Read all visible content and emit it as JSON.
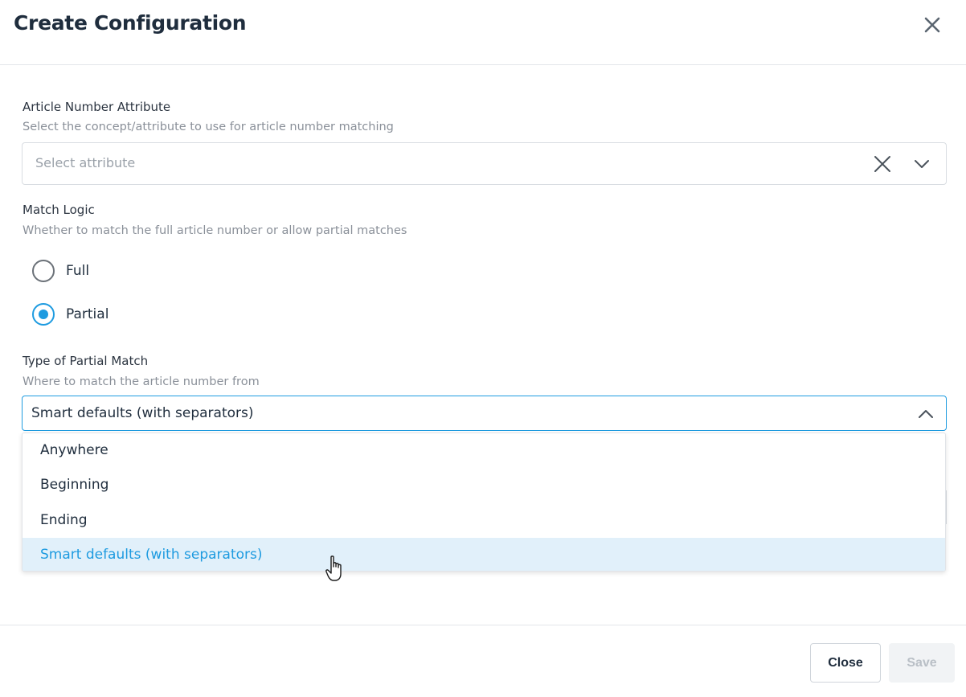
{
  "dialog": {
    "title": "Create Configuration"
  },
  "article_attribute": {
    "label": "Article Number Attribute",
    "help": "Select the concept/attribute to use for article number matching",
    "placeholder": "Select attribute"
  },
  "match_logic": {
    "label": "Match Logic",
    "help": "Whether to match the full article number or allow partial matches",
    "options": [
      {
        "label": "Full",
        "checked": false
      },
      {
        "label": "Partial",
        "checked": true
      }
    ]
  },
  "partial_match": {
    "label": "Type of Partial Match",
    "help": "Where to match the article number from",
    "value": "Smart defaults (with separators)",
    "options": [
      "Anywhere",
      "Beginning",
      "Ending",
      "Smart defaults (with separators)"
    ],
    "selected_index": 3
  },
  "footer": {
    "close_label": "Close",
    "save_label": "Save"
  },
  "colors": {
    "accent": "#1e9be0",
    "selected_bg": "#e1f0fa",
    "text": "#1f2d3d",
    "muted": "#8a9099"
  },
  "icons": {
    "dialog_close": "close-icon",
    "clear": "clear-icon",
    "dropdown": "chevron-down-icon",
    "dropdown_open": "chevron-up-icon",
    "cursor": "hand-pointer-icon"
  }
}
